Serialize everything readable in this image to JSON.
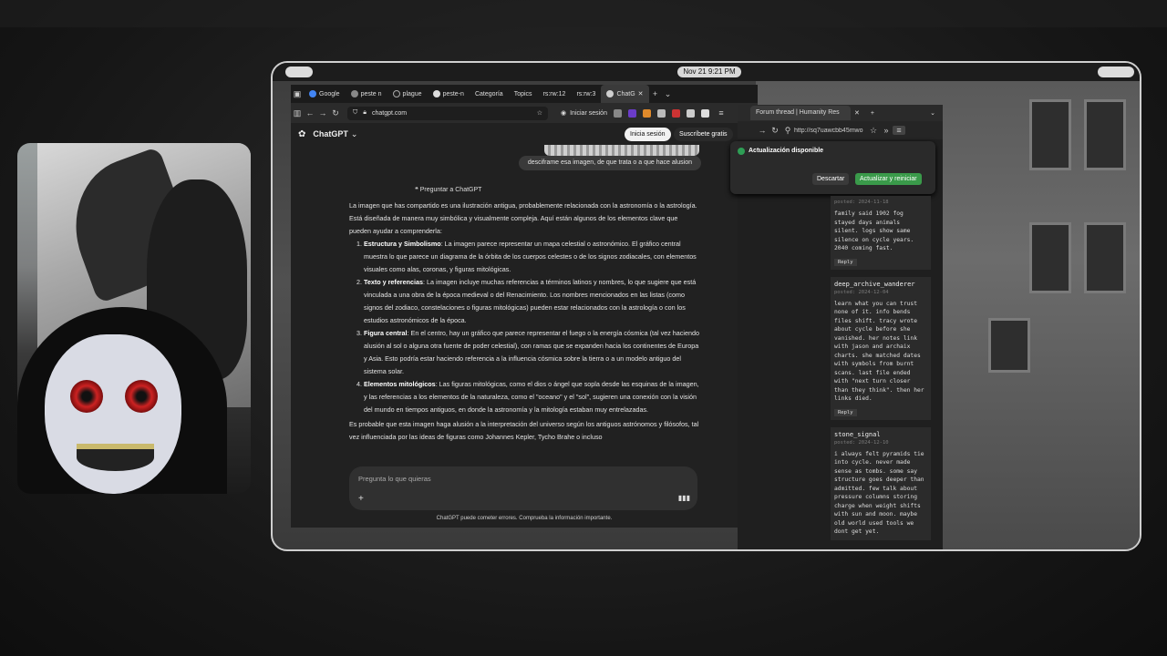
{
  "topbar": {
    "clock": "Nov 21   9:21 PM"
  },
  "browser": {
    "tabs": [
      {
        "label": "Google"
      },
      {
        "label": "peste n"
      },
      {
        "label": "plague"
      },
      {
        "label": "peste-n"
      },
      {
        "label": "Categoría"
      },
      {
        "label": "Topics"
      },
      {
        "label": "rs:rw:12"
      },
      {
        "label": "rs:rw:3"
      },
      {
        "label": "ChatG"
      }
    ],
    "url": "chatgpt.com",
    "login_label": "Iniciar sesión"
  },
  "chat": {
    "model": "ChatGPT",
    "login_button": "Inicia sesión",
    "signup_button": "Suscríbete gratis",
    "user_message": "desciframe esa imagen, de que trata o a que hace alusion",
    "ask_button": "Preguntar a ChatGPT",
    "intro": "La imagen que has compartido es una ilustración antigua, probablemente relacionada con la astronomía o la astrología. Está diseñada de manera muy simbólica y visualmente compleja. Aquí están algunos de los elementos clave que pueden ayudar a comprenderla:",
    "items": [
      {
        "title": "Estructura y Simbolismo",
        "text": ": La imagen parece representar un mapa celestial o astronómico. El gráfico central muestra lo que parece un diagrama de la órbita de los cuerpos celestes o de los signos zodiacales, con elementos visuales como alas, coronas, y figuras mitológicas."
      },
      {
        "title": "Texto y referencias",
        "text": ": La imagen incluye muchas referencias a términos latinos y nombres, lo que sugiere que está vinculada a una obra de la época medieval o del Renacimiento. Los nombres mencionados en las listas (como signos del zodiaco, constelaciones o figuras mitológicas) pueden estar relacionados con la astrología o con los estudios astronómicos de la época."
      },
      {
        "title": "Figura central",
        "text": ": En el centro, hay un gráfico que parece representar el fuego o la energía cósmica (tal vez haciendo alusión al sol o alguna otra fuente de poder celestial), con ramas que se expanden hacia los continentes de Europa y Asia. Esto podría estar haciendo referencia a la influencia cósmica sobre la tierra o a un modelo antiguo del sistema solar."
      },
      {
        "title": "Elementos mitológicos",
        "text": ": Las figuras mitológicas, como el dios o ángel que sopla desde las esquinas de la imagen, y las referencias a los elementos de la naturaleza, como el \"oceano\" y el \"sol\", sugieren una conexión con la visión del mundo en tiempos antiguos, en donde la astronomía y la mitología estaban muy entrelazadas."
      }
    ],
    "outro": "Es probable que esta imagen haga alusión a la interpretación del universo según los antiguos astrónomos y filósofos, tal vez influenciada por las ideas de figuras como Johannes Kepler, Tycho Brahe o incluso",
    "composer_placeholder": "Pregunta lo que quieras",
    "disclaimer": "ChatGPT puede cometer errores. Comprueba la información importante."
  },
  "browser2": {
    "tab_label": "Forum thread | Humanity Res",
    "url": "http://sq7uawcbb45mwo",
    "popup_title": "Actualización disponible",
    "dismiss_label": "Descartar",
    "update_label": "Actualizar y reiniciar"
  },
  "forum": {
    "posts": [
      {
        "user": "",
        "date": "posted: 2024-11-18",
        "body": "family said 1902 fog stayed days animals silent. logs show same silence on cycle years. 2040 coming fast.",
        "reply": "Reply"
      },
      {
        "user": "deep_archive_wanderer",
        "date": "posted: 2024-12-04",
        "body": "learn what you can trust none of it. info bends files shift. tracy wrote about cycle before she vanished. her notes link with jason and archaix charts. she matched dates with symbols from burnt scans. last file ended with \"next turn closer than they think\". then her links died.",
        "reply": "Reply"
      },
      {
        "user": "stone_signal",
        "date": "posted: 2024-12-10",
        "body": "i always felt pyramids tie into cycle. never made sense as tombs. some say structure goes deeper than admitted. few talk about pressure columns storing charge when weight shifts with sun and moon. maybe old world used tools we dont get yet.",
        "reply": ""
      }
    ]
  }
}
